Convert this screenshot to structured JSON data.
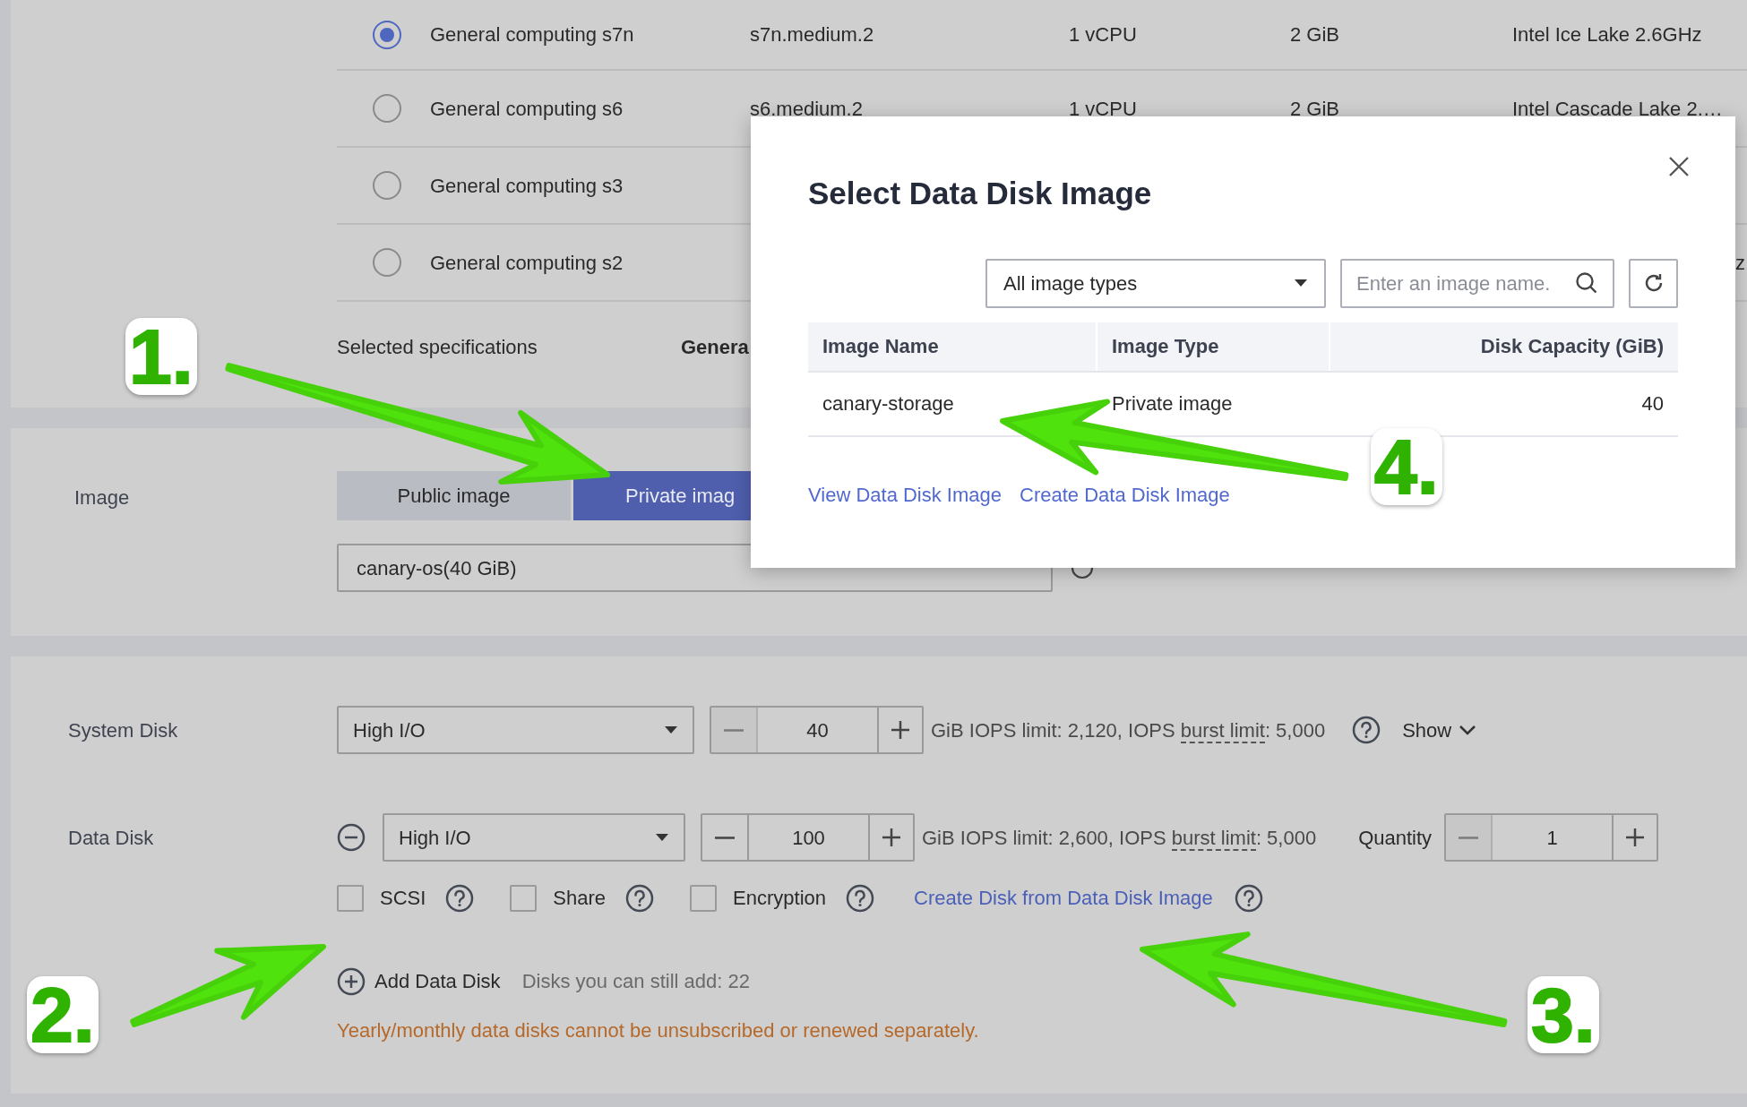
{
  "specs": {
    "rows": [
      {
        "selected": true,
        "name": "General computing s7n",
        "flavor": "s7n.medium.2",
        "vcpus": "1 vCPU",
        "memory": "2 GiB",
        "cpu": "Intel Ice Lake 2.6GHz"
      },
      {
        "selected": false,
        "name": "General computing s6",
        "flavor": "s6.medium.2",
        "vcpus": "1 vCPU",
        "memory": "2 GiB",
        "cpu": "Intel Cascade Lake 2.…"
      },
      {
        "selected": false,
        "name": "General computing s3"
      },
      {
        "selected": false,
        "name": "General computing s2",
        "cpu_tail": "z"
      }
    ],
    "selected_label": "Selected specifications",
    "selected_value": "Genera"
  },
  "image": {
    "label": "Image",
    "tabs": [
      {
        "label": "Public image",
        "selected": false
      },
      {
        "label": "Private imag",
        "selected": true
      }
    ],
    "dropdown": "canary-os(40 GiB)"
  },
  "system_disk": {
    "label": "System Disk",
    "type": "High I/O",
    "size": "40",
    "minus_disabled": true,
    "info": "GiB IOPS limit: 2,120, IOPS ",
    "term": "burst limit",
    "info_end": ": 5,000",
    "show": "Show"
  },
  "data_disk": {
    "label": "Data Disk",
    "type": "High I/O",
    "size": "100",
    "minus_disabled": false,
    "info": "GiB IOPS limit: 2,600, IOPS ",
    "term": "burst limit",
    "info_end": ": 5,000",
    "quantity_label": "Quantity",
    "quantity": "1",
    "quantity_minus_disabled": true,
    "options": [
      {
        "label": "SCSI",
        "checked": false
      },
      {
        "label": "Share",
        "checked": false
      },
      {
        "label": "Encryption",
        "checked": false
      }
    ],
    "link": "Create Disk from Data Disk Image",
    "add": "Add Data Disk",
    "remaining": "Disks you can still add: 22",
    "warning": "Yearly/monthly data disks cannot be unsubscribed or renewed separately."
  },
  "dialog": {
    "title": "Select Data Disk Image",
    "filter": "All image types",
    "search": {
      "placeholder": "Enter an image name."
    },
    "columns": [
      "Image Name",
      "Image Type",
      "Disk Capacity (GiB)"
    ],
    "rows": [
      [
        "canary-storage",
        "Private image",
        "40"
      ]
    ],
    "links": [
      "View Data Disk Image",
      "Create Data Disk Image"
    ]
  },
  "annotations": [
    "1.",
    "2.",
    "3.",
    "4."
  ]
}
